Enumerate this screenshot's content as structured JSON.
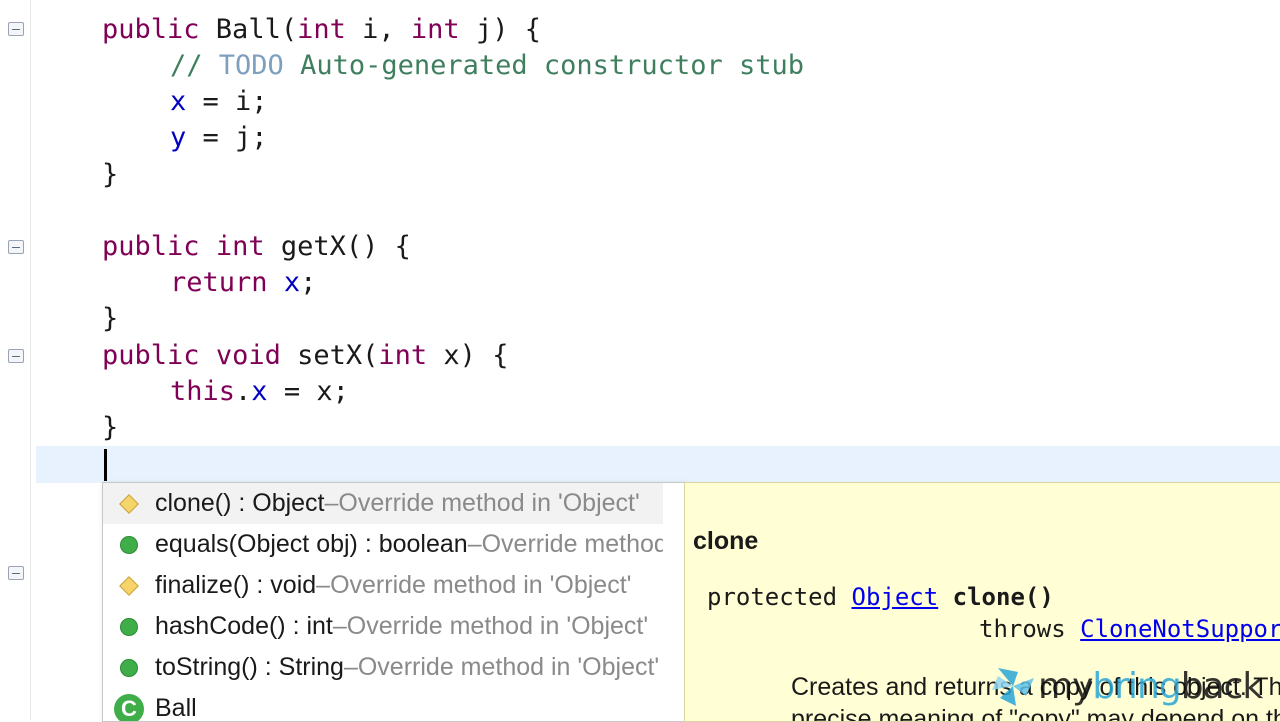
{
  "editor": {
    "lines": {
      "l1": {
        "kw1": "public",
        "t1": " Ball(",
        "kw2": "int",
        "t2": " i, ",
        "kw3": "int",
        "t3": " j) {"
      },
      "l2": {
        "comment_start": "// ",
        "todo": "TODO",
        "comment_rest": " Auto-generated constructor stub"
      },
      "l3": {
        "field": "x",
        "rest": " = i;"
      },
      "l4": {
        "field": "y",
        "rest": " = j;"
      },
      "l5": {
        "brace": "}"
      },
      "l6": {
        "kw1": "public",
        "sp": " ",
        "kw2": "int",
        "rest": " getX() {"
      },
      "l7": {
        "kw": "return",
        "sp": " ",
        "field": "x",
        "rest": ";"
      },
      "l8": {
        "brace": "}"
      },
      "l9": {
        "kw1": "public",
        "sp": " ",
        "kw2": "void",
        "rest1": " setX(",
        "kw3": "int",
        "rest2": " x) {"
      },
      "l10": {
        "kw": "this",
        "dot": ".",
        "field": "x",
        "rest": " = x;"
      },
      "l11": {
        "brace": "}"
      }
    }
  },
  "autocomplete": {
    "items": [
      {
        "icon": "protected-method-icon",
        "main": "clone() : Object",
        "sep": " – ",
        "detail": "Override method in 'Object'"
      },
      {
        "icon": "public-method-icon",
        "main": "equals(Object obj) : boolean",
        "sep": " – ",
        "detail": "Override method in 'Object'"
      },
      {
        "icon": "protected-method-icon",
        "main": "finalize() : void",
        "sep": " – ",
        "detail": "Override method in 'Object'"
      },
      {
        "icon": "public-method-icon",
        "main": "hashCode() : int",
        "sep": " – ",
        "detail": "Override method in 'Object'"
      },
      {
        "icon": "public-method-icon",
        "main": "toString() : String",
        "sep": " – ",
        "detail": "Override method in 'Object'"
      },
      {
        "icon": "class-icon",
        "icon_letter": "C",
        "main": "Ball",
        "sep": "",
        "detail": ""
      }
    ]
  },
  "javadoc": {
    "title": "clone",
    "sig_modifier": "protected ",
    "sig_type": "Object",
    "sig_name": " clone()",
    "throws_label": "throws ",
    "throws_type": "CloneNotSupportedException",
    "description_1": "Creates and returns a copy of this object. The",
    "description_2": "precise meaning of \"copy\" may depend on the class"
  },
  "watermark": {
    "part1": "my",
    "part2": "bring",
    "part3": "back"
  }
}
